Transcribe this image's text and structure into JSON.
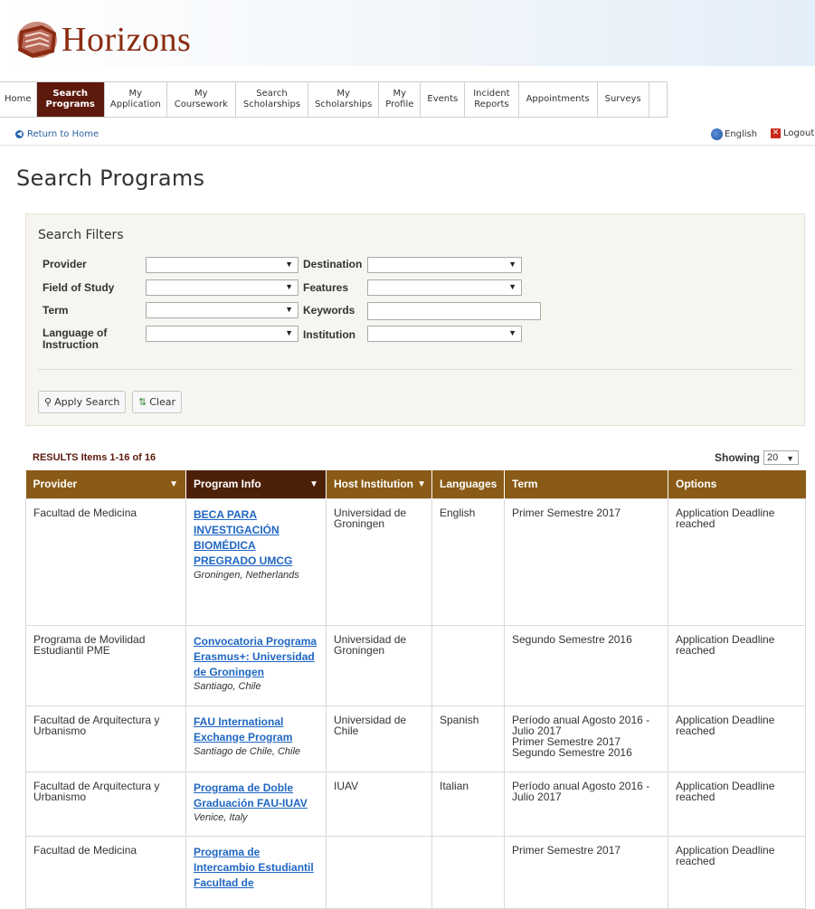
{
  "header": {
    "logo_text": "Horizons"
  },
  "nav": {
    "items": [
      {
        "label": "Home"
      },
      {
        "label": "Search\nPrograms",
        "active": true
      },
      {
        "label": "My\nApplication"
      },
      {
        "label": "My\nCoursework"
      },
      {
        "label": "Search\nScholarships"
      },
      {
        "label": "My\nScholarships"
      },
      {
        "label": "My\nProfile"
      },
      {
        "label": "Events"
      },
      {
        "label": "Incident\nReports"
      },
      {
        "label": "Appointments"
      },
      {
        "label": "Surveys"
      }
    ]
  },
  "subbar": {
    "return_label": "Return to Home",
    "language_label": "English",
    "logout_label": "Logout"
  },
  "page": {
    "title": "Search Programs"
  },
  "filters": {
    "title": "Search Filters",
    "provider_label": "Provider",
    "field_label": "Field of Study",
    "term_label": "Term",
    "language_label": "Language of\nInstruction",
    "destination_label": "Destination",
    "features_label": "Features",
    "keywords_label": "Keywords",
    "institution_label": "Institution",
    "apply_label": "Apply Search",
    "clear_label": "Clear"
  },
  "results": {
    "summary": "RESULTS Items 1-16 of 16",
    "showing_label": "Showing",
    "page_size": "20",
    "columns": [
      "Provider",
      "Program Info",
      "Host Institution",
      "Languages",
      "Term",
      "Options"
    ],
    "rows": [
      {
        "provider": "Facultad de Medicina",
        "program": "BECA PARA INVESTIGACIÓN BIOMÉDICA PREGRADO UMCG",
        "location": "Groningen, Netherlands",
        "host": "Universidad de Groningen",
        "languages": "English",
        "term": "Primer Semestre 2017",
        "options": "Application Deadline reached"
      },
      {
        "provider": "Programa de Movilidad Estudiantil PME",
        "program": "Convocatoria Programa Erasmus+: Universidad de Groningen",
        "location": "Santiago, Chile",
        "host": "Universidad de Groningen",
        "languages": "",
        "term": "Segundo Semestre 2016",
        "options": "Application Deadline reached"
      },
      {
        "provider": "Facultad de Arquitectura y Urbanismo",
        "program": "FAU International Exchange Program",
        "location": "Santiago de Chile, Chile",
        "host": "Universidad de Chile",
        "languages": "Spanish",
        "term": "Período anual Agosto 2016 - Julio 2017\nPrimer Semestre 2017\nSegundo Semestre 2016",
        "options": "Application Deadline reached"
      },
      {
        "provider": "Facultad de Arquitectura y Urbanismo",
        "program": "Programa de Doble Graduación FAU-IUAV",
        "location": "Venice, Italy",
        "host": "IUAV",
        "languages": "Italian",
        "term": "Período anual Agosto 2016 - Julio 2017",
        "options": "Application Deadline reached"
      },
      {
        "provider": "Facultad de Medicina",
        "program": "Programa de Intercambio Estudiantil Facultad de",
        "location": "",
        "host": "",
        "languages": "",
        "term": "Primer Semestre 2017",
        "options": "Application Deadline reached"
      }
    ]
  }
}
